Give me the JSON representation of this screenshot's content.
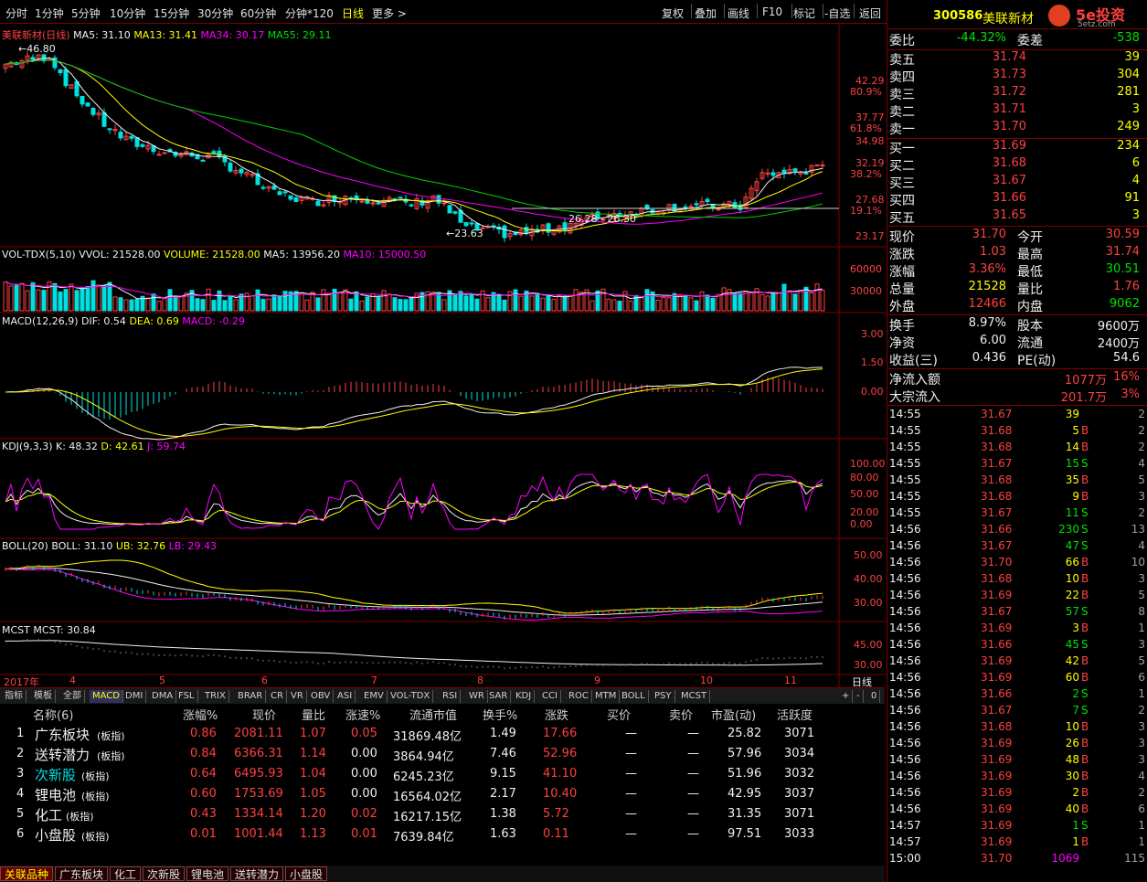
{
  "toolbar": {
    "periods": [
      "分时",
      "1分钟",
      "5分钟",
      "10分钟",
      "15分钟",
      "30分钟",
      "60分钟",
      "分钟*120",
      "日线",
      "更多 >"
    ],
    "selected_index": 8,
    "buttons": [
      "复权",
      "叠加",
      "画线",
      "F10",
      "标记",
      "-自选",
      "返回"
    ]
  },
  "stock": {
    "code": "300586",
    "name": "美联新材",
    "logo_text": "5e投资",
    "logo_sub": "5etz.com"
  },
  "main_chart": {
    "legend": [
      "美联新材(日线)",
      "MA5: 31.10",
      "MA13: 31.41",
      "MA34: 30.17",
      "MA55: 29.11"
    ],
    "price_labels": [
      "42.29",
      "80.9%",
      "37.77",
      "61.8%",
      "34.98",
      "32.19",
      "38.2%",
      "27.68",
      "19.1%",
      "23.17"
    ],
    "annotations": [
      "46.80",
      "26.28 - 26.30",
      "23.63"
    ]
  },
  "vol_chart": {
    "legend": [
      "VOL-TDX(5,10)",
      "VVOL: 21528.00",
      "VOLUME: 21528.00",
      "MA5: 13956.20",
      "MA10: 15000.50"
    ],
    "labels": [
      "60000",
      "30000"
    ]
  },
  "macd_chart": {
    "legend": [
      "MACD(12,26,9)",
      "DIF: 0.54",
      "DEA: 0.69",
      "MACD: -0.29"
    ],
    "labels": [
      "3.00",
      "1.50",
      "0.00"
    ]
  },
  "kdj_chart": {
    "legend": [
      "KDJ(9,3,3)",
      "K: 48.32",
      "D: 42.61",
      "J: 59.74"
    ],
    "labels": [
      "100.00",
      "80.00",
      "50.00",
      "20.00",
      "0.00"
    ]
  },
  "boll_chart": {
    "legend": [
      "BOLL(20)",
      "BOLL: 31.10",
      "UB: 32.76",
      "LB: 29.43"
    ],
    "labels": [
      "50.00",
      "40.00",
      "30.00"
    ]
  },
  "mcst_chart": {
    "legend": [
      "MCST",
      "MCST: 30.84"
    ],
    "labels": [
      "45.00",
      "30.00"
    ]
  },
  "date_axis": {
    "labels": [
      "2017年",
      "4",
      "5",
      "6",
      "7",
      "8",
      "9",
      "10",
      "11"
    ],
    "period": "日线"
  },
  "indicator_tabs": [
    "指标",
    "模板",
    "全部",
    "MACD",
    "DMI",
    "DMA",
    "FSL",
    "TRIX",
    "BRAR",
    "CR",
    "VR",
    "OBV",
    "ASI",
    "EMV",
    "VOL-TDX",
    "RSI",
    "WR",
    "SAR",
    "KDJ",
    "CCI",
    "ROC",
    "MTM",
    "BOLL",
    "PSY",
    "MCST"
  ],
  "indicator_selected": 3,
  "indicator_controls": [
    "+",
    "-",
    "0"
  ],
  "sector_table": {
    "headers": [
      "名称(6)",
      "涨幅%",
      "现价",
      "量比",
      "涨速%",
      "流通市值",
      "换手%",
      "涨跌",
      "买价",
      "卖价",
      "市盈(动)",
      "活跃度"
    ],
    "rows": [
      {
        "n": "1",
        "name": "广东板块",
        "tag": "(板指)",
        "chg": "0.86",
        "price": "2081.11",
        "lb": "1.07",
        "speed": "0.05",
        "cap": "31869.48亿",
        "turn": "1.49",
        "diff": "17.66",
        "bid": "—",
        "ask": "—",
        "pe": "25.82",
        "act": "3071"
      },
      {
        "n": "2",
        "name": "送转潜力",
        "tag": "(板指)",
        "chg": "0.84",
        "price": "6366.31",
        "lb": "1.14",
        "speed": "0.00",
        "cap": "3864.94亿",
        "turn": "7.46",
        "diff": "52.96",
        "bid": "—",
        "ask": "—",
        "pe": "57.96",
        "act": "3034"
      },
      {
        "n": "3",
        "name": "次新股",
        "tag": "(板指)",
        "chg": "0.64",
        "price": "6495.93",
        "lb": "1.04",
        "speed": "0.00",
        "cap": "6245.23亿",
        "turn": "9.15",
        "diff": "41.10",
        "bid": "—",
        "ask": "—",
        "pe": "51.96",
        "act": "3032"
      },
      {
        "n": "4",
        "name": "锂电池",
        "tag": "(板指)",
        "chg": "0.60",
        "price": "1753.69",
        "lb": "1.05",
        "speed": "0.00",
        "cap": "16564.02亿",
        "turn": "2.17",
        "diff": "10.40",
        "bid": "—",
        "ask": "—",
        "pe": "42.95",
        "act": "3037"
      },
      {
        "n": "5",
        "name": "化工",
        "tag": "(板指)",
        "chg": "0.43",
        "price": "1334.14",
        "lb": "1.20",
        "speed": "0.02",
        "cap": "16217.15亿",
        "turn": "1.38",
        "diff": "5.72",
        "bid": "—",
        "ask": "—",
        "pe": "31.35",
        "act": "3071"
      },
      {
        "n": "6",
        "name": "小盘股",
        "tag": "(板指)",
        "chg": "0.01",
        "price": "1001.44",
        "lb": "1.13",
        "speed": "0.01",
        "cap": "7639.84亿",
        "turn": "1.63",
        "diff": "0.11",
        "bid": "—",
        "ask": "—",
        "pe": "97.51",
        "act": "3033"
      }
    ]
  },
  "bottom_tabs": [
    "关联品种",
    "广东板块",
    "化工",
    "次新股",
    "锂电池",
    "送转潜力",
    "小盘股"
  ],
  "quote": {
    "wb": {
      "l1": "委比",
      "v1": "-44.32%",
      "l2": "委差",
      "v2": "-538"
    },
    "sells": [
      {
        "l": "卖五",
        "p": "31.74",
        "v": "39"
      },
      {
        "l": "卖四",
        "p": "31.73",
        "v": "304"
      },
      {
        "l": "卖三",
        "p": "31.72",
        "v": "281"
      },
      {
        "l": "卖二",
        "p": "31.71",
        "v": "3"
      },
      {
        "l": "卖一",
        "p": "31.70",
        "v": "249"
      }
    ],
    "buys": [
      {
        "l": "买一",
        "p": "31.69",
        "v": "234"
      },
      {
        "l": "买二",
        "p": "31.68",
        "v": "6"
      },
      {
        "l": "买三",
        "p": "31.67",
        "v": "4"
      },
      {
        "l": "买四",
        "p": "31.66",
        "v": "91"
      },
      {
        "l": "买五",
        "p": "31.65",
        "v": "3"
      }
    ],
    "stats": [
      {
        "l1": "现价",
        "v1": "31.70",
        "l2": "今开",
        "v2": "30.59"
      },
      {
        "l1": "涨跌",
        "v1": "1.03",
        "l2": "最高",
        "v2": "31.74"
      },
      {
        "l1": "涨幅",
        "v1": "3.36%",
        "l2": "最低",
        "v2": "30.51"
      },
      {
        "l1": "总量",
        "v1": "21528",
        "l2": "量比",
        "v2": "1.76"
      },
      {
        "l1": "外盘",
        "v1": "12466",
        "l2": "内盘",
        "v2": "9062"
      }
    ],
    "info": [
      {
        "l1": "换手",
        "v1": "8.97%",
        "l2": "股本",
        "v2": "9600万"
      },
      {
        "l1": "净资",
        "v1": "6.00",
        "l2": "流通",
        "v2": "2400万"
      },
      {
        "l1": "收益(三)",
        "v1": "0.436",
        "l2": "PE(动)",
        "v2": "54.6"
      }
    ],
    "flow": [
      {
        "l": "净流入额",
        "v": "1077万",
        "p": "16%"
      },
      {
        "l": "大宗流入",
        "v": "201.7万",
        "p": "3%"
      }
    ]
  },
  "ticks": [
    {
      "t": "14:55",
      "p": "31.67",
      "v": "39",
      "s": "",
      "n": "2"
    },
    {
      "t": "14:55",
      "p": "31.68",
      "v": "5",
      "s": "B",
      "n": "2"
    },
    {
      "t": "14:55",
      "p": "31.68",
      "v": "14",
      "s": "B",
      "n": "2"
    },
    {
      "t": "14:55",
      "p": "31.67",
      "v": "15",
      "s": "S",
      "n": "4"
    },
    {
      "t": "14:55",
      "p": "31.68",
      "v": "35",
      "s": "B",
      "n": "5"
    },
    {
      "t": "14:55",
      "p": "31.68",
      "v": "9",
      "s": "B",
      "n": "3"
    },
    {
      "t": "14:55",
      "p": "31.67",
      "v": "11",
      "s": "S",
      "n": "2"
    },
    {
      "t": "14:56",
      "p": "31.66",
      "v": "230",
      "s": "S",
      "n": "13"
    },
    {
      "t": "14:56",
      "p": "31.67",
      "v": "47",
      "s": "S",
      "n": "4"
    },
    {
      "t": "14:56",
      "p": "31.70",
      "v": "66",
      "s": "B",
      "n": "10"
    },
    {
      "t": "14:56",
      "p": "31.68",
      "v": "10",
      "s": "B",
      "n": "3"
    },
    {
      "t": "14:56",
      "p": "31.69",
      "v": "22",
      "s": "B",
      "n": "5"
    },
    {
      "t": "14:56",
      "p": "31.67",
      "v": "57",
      "s": "S",
      "n": "8"
    },
    {
      "t": "14:56",
      "p": "31.69",
      "v": "3",
      "s": "B",
      "n": "1"
    },
    {
      "t": "14:56",
      "p": "31.66",
      "v": "45",
      "s": "S",
      "n": "3"
    },
    {
      "t": "14:56",
      "p": "31.69",
      "v": "42",
      "s": "B",
      "n": "5"
    },
    {
      "t": "14:56",
      "p": "31.69",
      "v": "60",
      "s": "B",
      "n": "6"
    },
    {
      "t": "14:56",
      "p": "31.66",
      "v": "2",
      "s": "S",
      "n": "1"
    },
    {
      "t": "14:56",
      "p": "31.67",
      "v": "7",
      "s": "S",
      "n": "2"
    },
    {
      "t": "14:56",
      "p": "31.68",
      "v": "10",
      "s": "B",
      "n": "3"
    },
    {
      "t": "14:56",
      "p": "31.69",
      "v": "26",
      "s": "B",
      "n": "3"
    },
    {
      "t": "14:56",
      "p": "31.69",
      "v": "48",
      "s": "B",
      "n": "3"
    },
    {
      "t": "14:56",
      "p": "31.69",
      "v": "30",
      "s": "B",
      "n": "4"
    },
    {
      "t": "14:56",
      "p": "31.69",
      "v": "2",
      "s": "B",
      "n": "2"
    },
    {
      "t": "14:56",
      "p": "31.69",
      "v": "40",
      "s": "B",
      "n": "6"
    },
    {
      "t": "14:57",
      "p": "31.69",
      "v": "1",
      "s": "S",
      "n": "1"
    },
    {
      "t": "14:57",
      "p": "31.69",
      "v": "1",
      "s": "B",
      "n": "1"
    },
    {
      "t": "15:00",
      "p": "31.70",
      "v": "1069",
      "s": "",
      "n": "115"
    }
  ],
  "colors": {
    "up": "#ff4040",
    "down": "#00e0e0",
    "ma5": "#f0f0f0",
    "ma13": "#ffff00",
    "ma34": "#ff00ff",
    "ma55": "#00d000",
    "grid": "#800000"
  }
}
